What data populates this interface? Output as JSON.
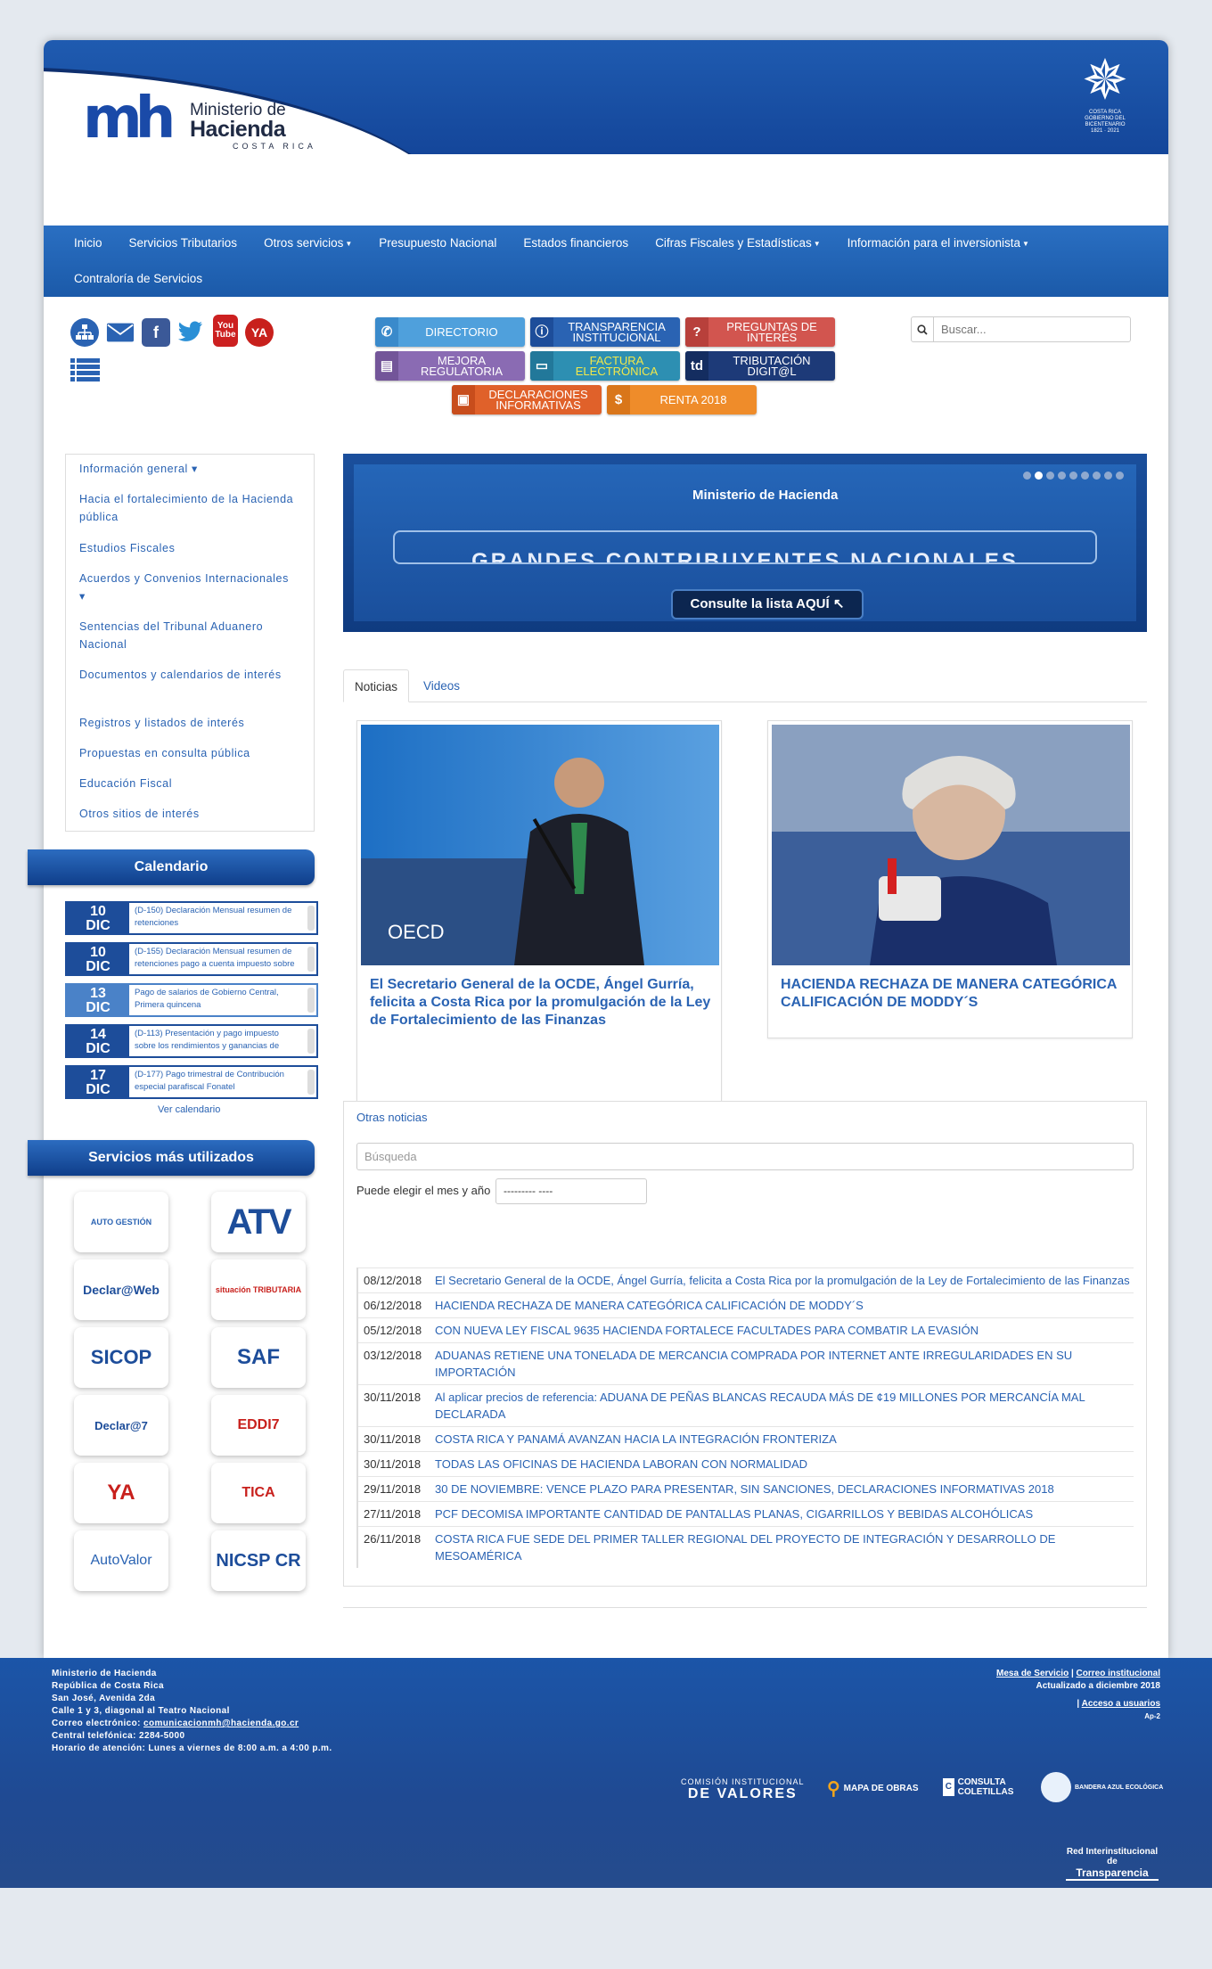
{
  "header": {
    "logo_mark": "mh",
    "logo_line1": "Ministerio de",
    "logo_line2": "Hacienda",
    "logo_line3": "COSTA RICA",
    "emblem_line1": "COSTA RICA",
    "emblem_line2": "GOBIERNO DEL BICENTENARIO",
    "emblem_line3": "1821 · 2021"
  },
  "nav": {
    "row1": [
      {
        "label": "Inicio",
        "dropdown": false
      },
      {
        "label": "Servicios Tributarios",
        "dropdown": false
      },
      {
        "label": "Otros servicios",
        "dropdown": true
      },
      {
        "label": "Presupuesto Nacional",
        "dropdown": false
      },
      {
        "label": "Estados financieros",
        "dropdown": false
      },
      {
        "label": "Cifras Fiscales y Estadísticas",
        "dropdown": true
      },
      {
        "label": "Información para el inversionista",
        "dropdown": true
      }
    ],
    "row2": [
      {
        "label": "Contraloría de Servicios",
        "dropdown": false
      }
    ]
  },
  "social": {
    "youtube_text": "You Tube",
    "denuncie_text": "YA"
  },
  "service_buttons": [
    {
      "label": "DIRECTORIO",
      "icon": "phone-icon"
    },
    {
      "label": "TRANSPARENCIA INSTITUCIONAL",
      "icon": "info-icon"
    },
    {
      "label": "PREGUNTAS DE INTERÉS",
      "icon": "question-icon"
    },
    {
      "label": "MEJORA REGULATORIA",
      "icon": "document-icon"
    },
    {
      "label": "FACTURA ELECTRÓNICA",
      "icon": "monitor-icon"
    },
    {
      "label": "TRIBUTACIÓN DIGIT@L",
      "icon": "td-icon"
    },
    {
      "label": "DECLARACIONES INFORMATIVAS",
      "icon": "screen-icon"
    },
    {
      "label": "RENTA 2018",
      "icon": "money-bag-icon"
    }
  ],
  "search": {
    "placeholder": "Buscar..."
  },
  "sidebar": {
    "items": [
      {
        "label": "Información general ▾"
      },
      {
        "label": "Hacia el fortalecimiento de la Hacienda pública"
      },
      {
        "label": "Estudios Fiscales"
      },
      {
        "label": "Acuerdos y Convenios Internacionales ▾"
      },
      {
        "label": "Sentencias del Tribunal Aduanero Nacional"
      },
      {
        "label": "Documentos y calendarios de interés"
      },
      {
        "label": "Registros y listados de interés"
      },
      {
        "label": "Propuestas en consulta pública"
      },
      {
        "label": "Educación Fiscal"
      },
      {
        "label": "Otros sitios de interés"
      }
    ]
  },
  "calendar": {
    "title": "Calendario",
    "items": [
      {
        "day": "10",
        "month": "DIC",
        "text": "(D-150) Declaración Mensual resumen de retenciones"
      },
      {
        "day": "10",
        "month": "DIC",
        "text": "(D-155) Declaración Mensual resumen de retenciones pago a cuenta impuesto sobre"
      },
      {
        "day": "13",
        "month": "DIC",
        "text": "Pago de salarios de Gobierno Central, Primera quincena"
      },
      {
        "day": "14",
        "month": "DIC",
        "text": "(D-113) Presentación y pago impuesto sobre los rendimientos y ganancias de"
      },
      {
        "day": "17",
        "month": "DIC",
        "text": "(D-177) Pago trimestral de Contribución especial parafiscal Fonatel"
      }
    ],
    "link": "Ver calendario"
  },
  "services": {
    "title": "Servicios más utilizados",
    "logos": [
      "AUTO GESTIÓN",
      "ATV",
      "Declar@Web",
      "situación TRIBUTARIA",
      "SICOP",
      "SAF",
      "Declar@7",
      "EDDI7",
      "YA",
      "TICA",
      "AutoValor",
      "NICSP CR"
    ]
  },
  "banner": {
    "brand": "Ministerio de Hacienda",
    "headline": "GRANDES CONTRIBUYENTES NACIONALES",
    "cta": "Consulte la lista AQUÍ",
    "slides": 9,
    "active_slide": 2
  },
  "tabs": [
    {
      "label": "Noticias",
      "active": true
    },
    {
      "label": "Videos",
      "active": false
    }
  ],
  "featured": [
    {
      "title": "El Secretario General de la OCDE, Ángel Gurría, felicita a Costa Rica por la promulgación de la Ley de Fortalecimiento de las Finanzas",
      "image": "photo of speaker at OECD podium",
      "image_text": "OECD"
    },
    {
      "title": "HACIENDA RECHAZA DE MANERA CATEGÓRICA CALIFICACIÓN DE MODDY´S",
      "image": "photo of woman speaking into microphones"
    }
  ],
  "others": {
    "title": "Otras noticias",
    "search_placeholder": "Búsqueda",
    "month_label": "Puede elegir el mes y año",
    "month_value": "--------- ----",
    "news": [
      {
        "date": "08/12/2018",
        "title": "El Secretario General de la OCDE, Ángel Gurría, felicita a Costa Rica por la promulgación de la Ley de Fortalecimiento de las Finanzas"
      },
      {
        "date": "06/12/2018",
        "title": "HACIENDA RECHAZA DE MANERA CATEGÓRICA CALIFICACIÓN DE MODDY´S"
      },
      {
        "date": "05/12/2018",
        "title": "CON NUEVA LEY FISCAL 9635 HACIENDA FORTALECE FACULTADES PARA COMBATIR LA EVASIÓN"
      },
      {
        "date": "03/12/2018",
        "title": "ADUANAS RETIENE UNA TONELADA DE MERCANCIA COMPRADA POR INTERNET ANTE IRREGULARIDADES EN SU IMPORTACIÓN"
      },
      {
        "date": "30/11/2018",
        "title": "Al aplicar precios de referencia: ADUANA DE PEÑAS BLANCAS RECAUDA MÁS DE ¢19 MILLONES POR MERCANCÍA MAL DECLARADA"
      },
      {
        "date": "30/11/2018",
        "title": "COSTA RICA Y PANAMÁ AVANZAN HACIA LA INTEGRACIÓN FRONTERIZA"
      },
      {
        "date": "30/11/2018",
        "title": "TODAS LAS OFICINAS DE HACIENDA LABORAN CON NORMALIDAD"
      },
      {
        "date": "29/11/2018",
        "title": "30 DE NOVIEMBRE: VENCE PLAZO PARA PRESENTAR, SIN SANCIONES, DECLARACIONES INFORMATIVAS 2018"
      },
      {
        "date": "27/11/2018",
        "title": "PCF DECOMISA IMPORTANTE CANTIDAD DE PANTALLAS PLANAS, CIGARRILLOS Y BEBIDAS ALCOHÓLICAS"
      },
      {
        "date": "26/11/2018",
        "title": "COSTA RICA FUE SEDE DEL PRIMER TALLER REGIONAL DEL PROYECTO DE INTEGRACIÓN Y DESARROLLO DE MESOAMÉRICA"
      }
    ]
  },
  "footer": {
    "lines": [
      "Ministerio de Hacienda",
      "República de Costa Rica",
      "San José, Avenida 2da",
      "Calle 1 y 3, diagonal al Teatro Nacional"
    ],
    "email_label": "Correo electrónico:",
    "email": "comunicacionmh@hacienda.go.cr",
    "phone": "Central telefónica: 2284-5000",
    "hours": "Horario de atención: Lunes a viernes de 8:00 a.m. a 4:00 p.m.",
    "link_mesa": "Mesa de Servicio",
    "link_correo": "Correo institucional",
    "updated": "Actualizado a diciembre 2018",
    "link_acceso": "Acceso a usuarios",
    "server": "Ap-2",
    "logos": {
      "valores_top": "COMISIÓN INSTITUCIONAL",
      "valores_bottom": "DE VALORES",
      "mapa": "MAPA DE OBRAS",
      "consulta": "CONSULTA COLETILLAS",
      "bandera": "BANDERA AZUL ECOLÓGICA",
      "red1": "Red Interinstitucional de",
      "red2": "Transparencia"
    }
  }
}
